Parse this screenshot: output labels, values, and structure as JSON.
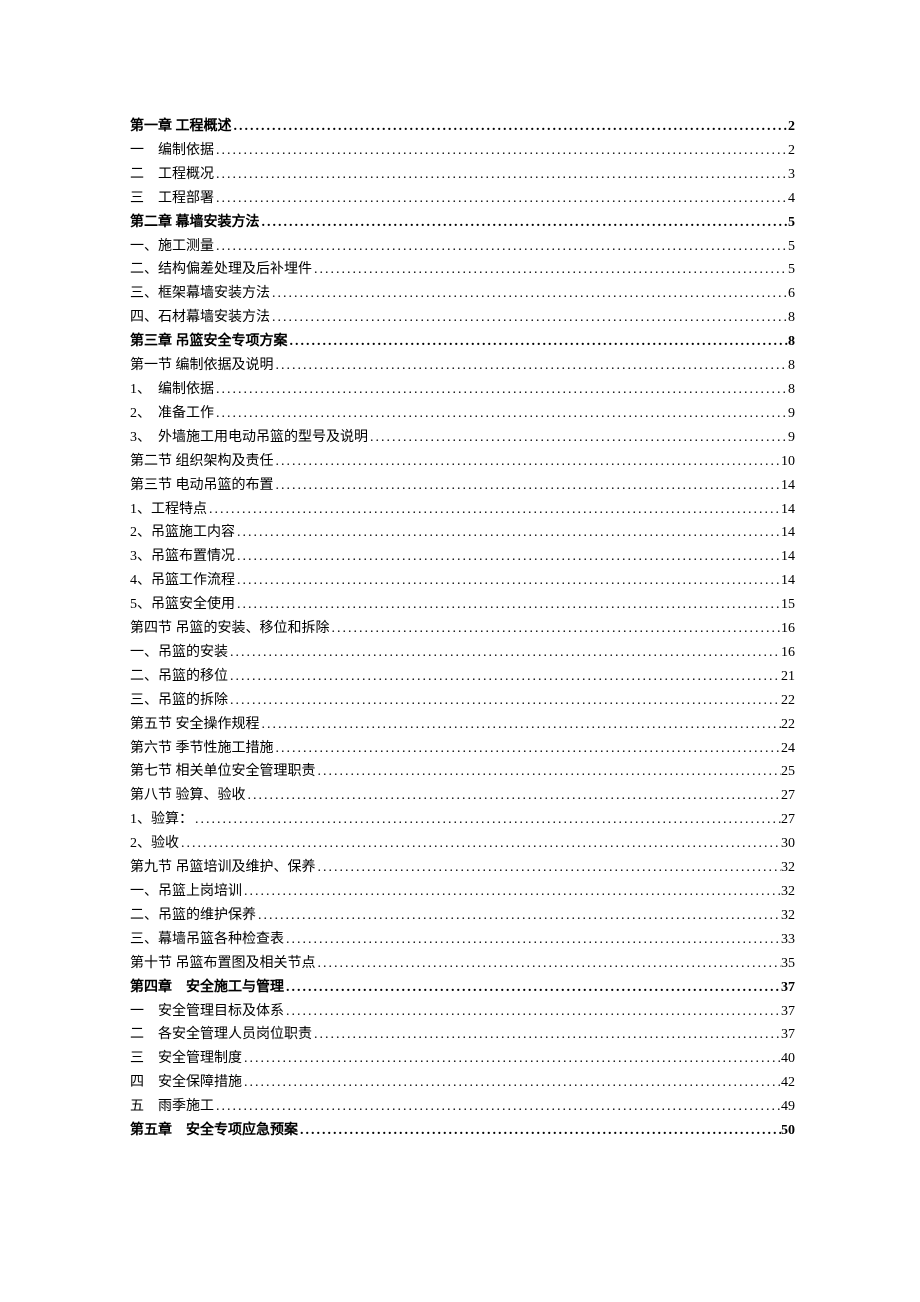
{
  "toc": [
    {
      "label": "第一章 工程概述",
      "page": "2",
      "bold": true
    },
    {
      "label": "一　编制依据",
      "page": "2"
    },
    {
      "label": "二　工程概况",
      "page": "3"
    },
    {
      "label": "三　工程部署",
      "page": "4"
    },
    {
      "label": "第二章 幕墙安装方法",
      "page": "5",
      "bold": true
    },
    {
      "label": "一、施工测量",
      "page": "5"
    },
    {
      "label": "二、结构偏差处理及后补埋件",
      "page": "5"
    },
    {
      "label": "三、框架幕墙安装方法",
      "page": "6"
    },
    {
      "label": "四、石材幕墙安装方法",
      "page": "8"
    },
    {
      "label": "第三章 吊篮安全专项方案",
      "page": "8",
      "bold": true
    },
    {
      "label": "第一节 编制依据及说明",
      "page": "8"
    },
    {
      "label": "1、　编制依据",
      "page": "8"
    },
    {
      "label": "2、　准备工作",
      "page": "9"
    },
    {
      "label": "3、　外墙施工用电动吊篮的型号及说明",
      "page": "9"
    },
    {
      "label": "第二节 组织架构及责任",
      "page": "10"
    },
    {
      "label": "第三节 电动吊篮的布置",
      "page": "14"
    },
    {
      "label": "1、工程特点",
      "page": "14"
    },
    {
      "label": "2、吊篮施工内容",
      "page": "14"
    },
    {
      "label": "3、吊篮布置情况",
      "page": "14"
    },
    {
      "label": "4、吊篮工作流程",
      "page": "14"
    },
    {
      "label": "5、吊篮安全使用",
      "page": "15"
    },
    {
      "label": "第四节 吊篮的安装、移位和拆除",
      "page": "16"
    },
    {
      "label": "一、吊篮的安装",
      "page": "16"
    },
    {
      "label": "二、吊篮的移位",
      "page": "21"
    },
    {
      "label": "三、吊篮的拆除",
      "page": "22"
    },
    {
      "label": "第五节 安全操作规程",
      "page": "22"
    },
    {
      "label": "第六节 季节性施工措施",
      "page": "24"
    },
    {
      "label": "第七节 相关单位安全管理职责",
      "page": "25"
    },
    {
      "label": "第八节 验算、验收",
      "page": "27"
    },
    {
      "label": "1、验算：",
      "page": "27"
    },
    {
      "label": "2、验收",
      "page": "30"
    },
    {
      "label": "第九节 吊篮培训及维护、保养",
      "page": "32"
    },
    {
      "label": "一、吊篮上岗培训",
      "page": "32"
    },
    {
      "label": "二、吊篮的维护保养",
      "page": "32"
    },
    {
      "label": "三、幕墙吊篮各种检查表",
      "page": "33"
    },
    {
      "label": "第十节 吊篮布置图及相关节点",
      "page": "35"
    },
    {
      "label": "第四章　安全施工与管理",
      "page": "37",
      "bold": true
    },
    {
      "label": "一　安全管理目标及体系",
      "page": "37"
    },
    {
      "label": "二　各安全管理人员岗位职责",
      "page": "37"
    },
    {
      "label": "三　安全管理制度",
      "page": "40"
    },
    {
      "label": "四　安全保障措施",
      "page": "42"
    },
    {
      "label": "五　雨季施工",
      "page": "49"
    },
    {
      "label": "第五章　安全专项应急预案",
      "page": "50",
      "bold": true
    }
  ]
}
